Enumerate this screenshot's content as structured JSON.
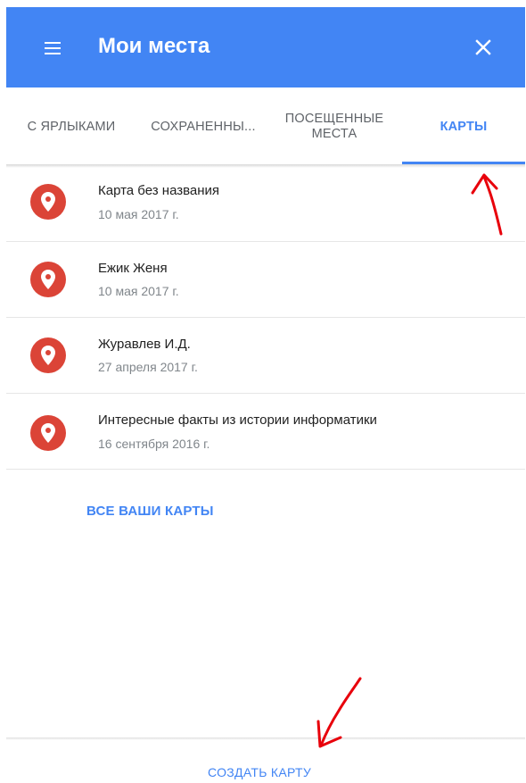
{
  "header": {
    "title": "Мои места",
    "menu_icon": "hamburger-menu-icon",
    "close_icon": "close-icon",
    "background_color": "#4285f4"
  },
  "tabs": [
    {
      "label": "С ЯРЛЫКАМИ",
      "active": false
    },
    {
      "label": "СОХРАНЕННЫ...",
      "active": false
    },
    {
      "label": "ПОСЕЩЕННЫЕ МЕСТА",
      "active": false
    },
    {
      "label": "КАРТЫ",
      "active": true
    }
  ],
  "maps": [
    {
      "title": "Карта без названия",
      "date": "10 мая 2017 г.",
      "icon": "map-pin-icon"
    },
    {
      "title": "Ежик Женя",
      "date": "10 мая 2017 г.",
      "icon": "map-pin-icon"
    },
    {
      "title": "Журавлев И.Д.",
      "date": "27 апреля 2017 г.",
      "icon": "map-pin-icon"
    },
    {
      "title": "Интересные факты из истории информатики",
      "date": "16 сентября 2016 г.",
      "icon": "map-pin-icon"
    }
  ],
  "all_maps_link": "ВСЕ ВАШИ КАРТЫ",
  "create_map_button": "СОЗДАТЬ КАРТУ",
  "colors": {
    "accent": "#4285f4",
    "pin": "#db4437",
    "annotation_arrow": "#e8000b"
  }
}
